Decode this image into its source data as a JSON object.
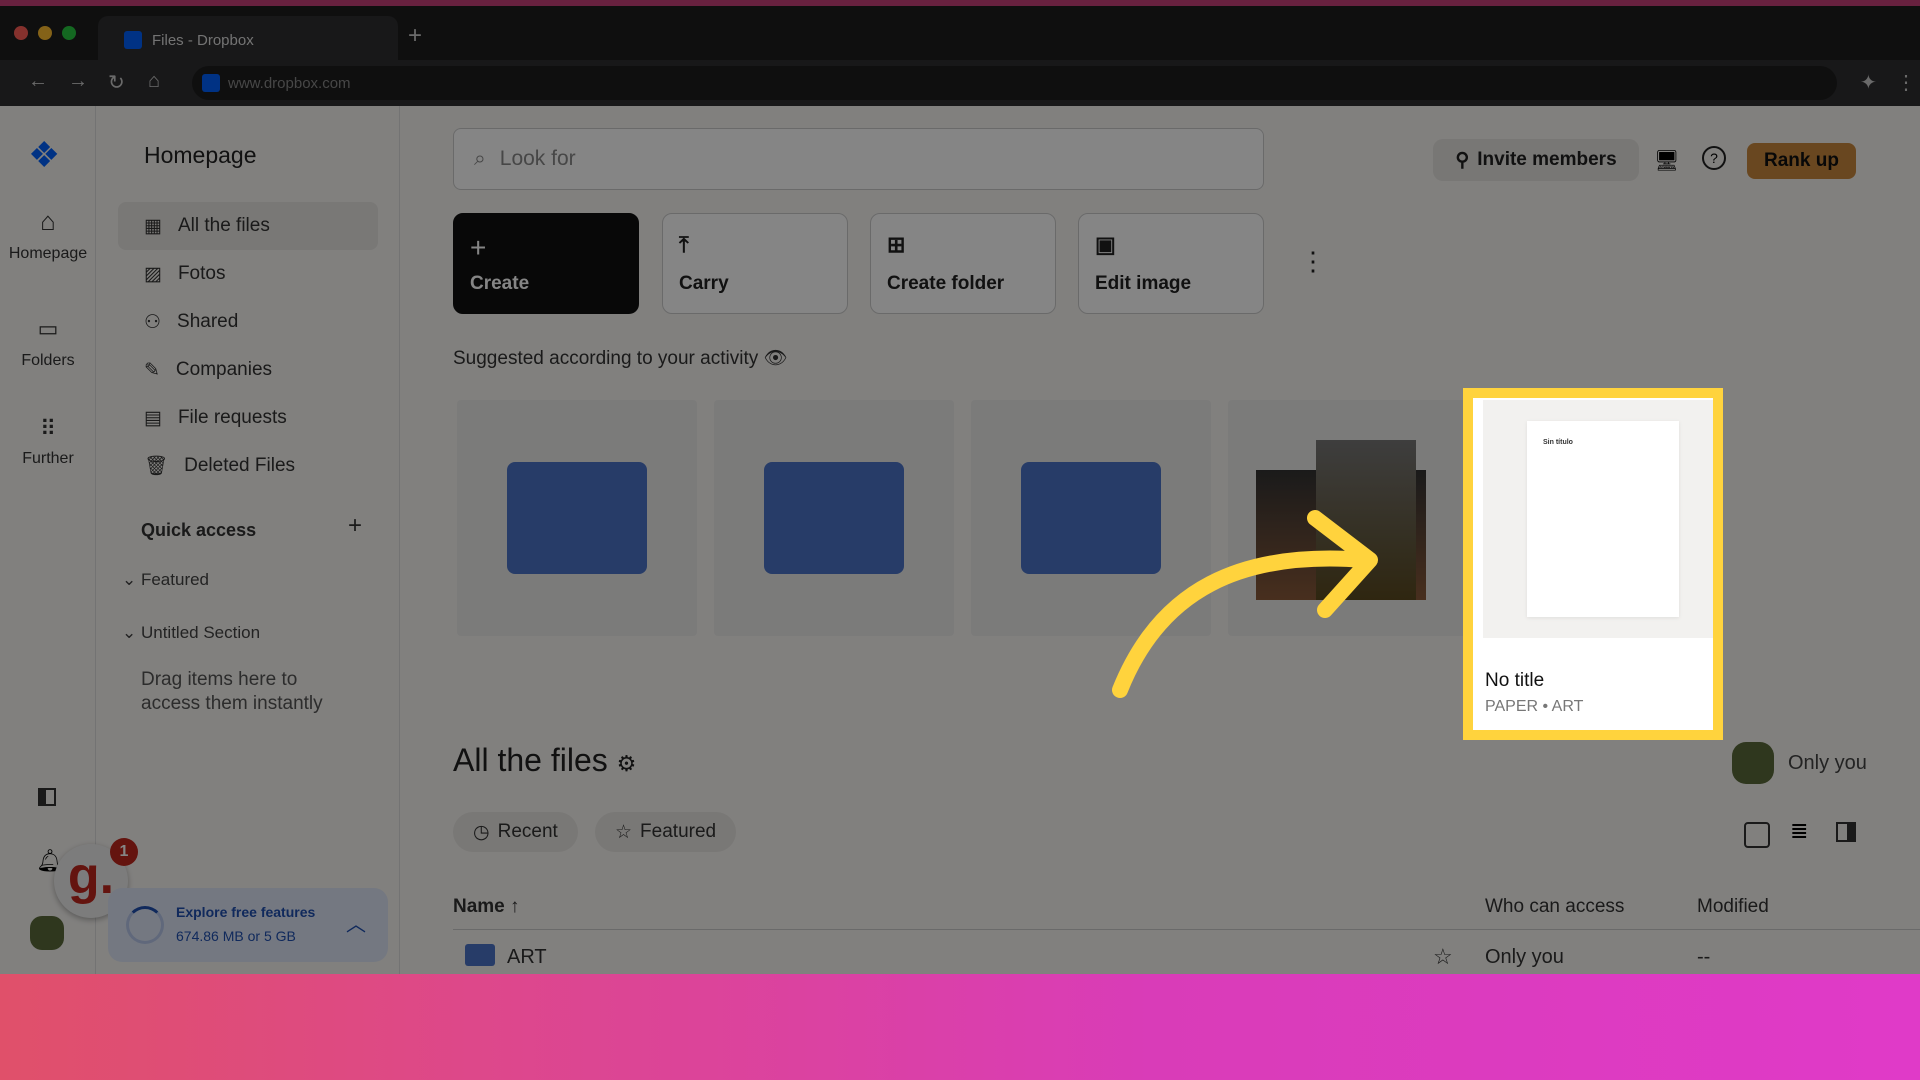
{
  "browser": {
    "tab_title": "Files - Dropbox",
    "url": "www.dropbox.com",
    "new_tab": "+"
  },
  "rail": {
    "items": [
      {
        "label": "Homepage",
        "icon": "home-icon"
      },
      {
        "label": "Folders",
        "icon": "folder-icon"
      },
      {
        "label": "Further",
        "icon": "grid-icon"
      }
    ]
  },
  "sidebar": {
    "title": "Homepage",
    "items": [
      {
        "label": "All the files"
      },
      {
        "label": "Fotos"
      },
      {
        "label": "Shared"
      },
      {
        "label": "Companies"
      },
      {
        "label": "File requests"
      },
      {
        "label": "Deleted Files"
      }
    ],
    "quick_access": "Quick access",
    "featured": "Featured",
    "untitled_section": "Untitled Section",
    "drag_hint": "Drag items here to access them instantly",
    "storage": {
      "title": "Explore free features",
      "usage": "674.86 MB or 5 GB"
    },
    "notification_count": "1",
    "badge_letter": "g."
  },
  "header": {
    "search_placeholder": "Look for",
    "invite": "Invite members",
    "rank_up": "Rank up"
  },
  "actions": [
    {
      "label": "Create",
      "icon": "plus-icon"
    },
    {
      "label": "Carry",
      "icon": "upload-icon"
    },
    {
      "label": "Create folder",
      "icon": "folder-plus-icon"
    },
    {
      "label": "Edit image",
      "icon": "image-edit-icon"
    }
  ],
  "suggested": {
    "title": "Suggested according to your activity",
    "highlighted": {
      "preview_text": "Sin título",
      "name": "No title",
      "meta": "PAPER • ART"
    }
  },
  "files": {
    "title": "All the files",
    "access_owner": "Only you",
    "filters": [
      "Recent",
      "Featured"
    ],
    "columns": {
      "name": "Name",
      "access": "Who can access",
      "modified": "Modified"
    },
    "rows": [
      {
        "name": "ART",
        "access": "Only you",
        "modified": "--"
      }
    ]
  },
  "colors": {
    "highlight": "#ffd33d",
    "arrow": "#ffd33d",
    "rank_up": "#c9893e",
    "storage_blue": "#1f4fb0"
  }
}
